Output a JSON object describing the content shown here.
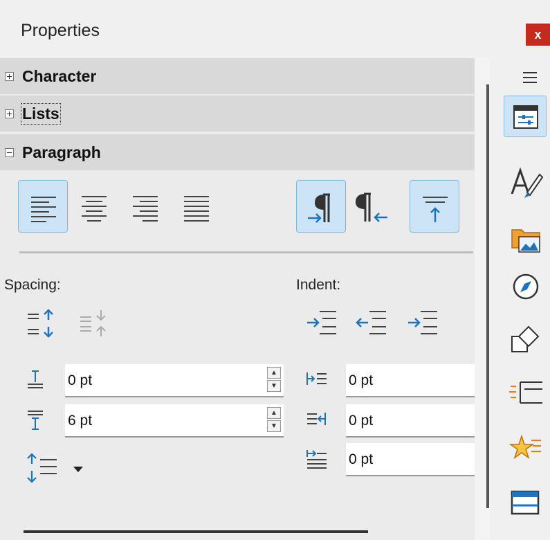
{
  "window": {
    "title": "Properties",
    "close_label": "x"
  },
  "sections": {
    "character": {
      "label": "Character",
      "expanded": false
    },
    "lists": {
      "label": "Lists",
      "expanded": false
    },
    "paragraph": {
      "label": "Paragraph",
      "expanded": true
    }
  },
  "paragraph": {
    "alignment_buttons": [
      {
        "name": "align-left-icon",
        "active": true
      },
      {
        "name": "align-center-icon",
        "active": false
      },
      {
        "name": "align-right-icon",
        "active": false
      },
      {
        "name": "align-justify-icon",
        "active": false
      }
    ],
    "direction_buttons": [
      {
        "name": "left-to-right-paragraph-icon",
        "active": true
      },
      {
        "name": "right-to-left-paragraph-icon",
        "active": false
      },
      {
        "name": "align-top-icon",
        "active": true
      }
    ],
    "spacing_label": "Spacing:",
    "indent_label": "Indent:",
    "above_spacing": "0 pt",
    "below_spacing": "6 pt",
    "before_indent": "0 pt",
    "after_indent": "0 pt",
    "first_line_indent": "0 pt"
  },
  "colors": {
    "accent_bg": "#cde4f7",
    "accent_border": "#7fb5e5",
    "icon_blue": "#1e73be",
    "close_red": "#c42b1c"
  }
}
